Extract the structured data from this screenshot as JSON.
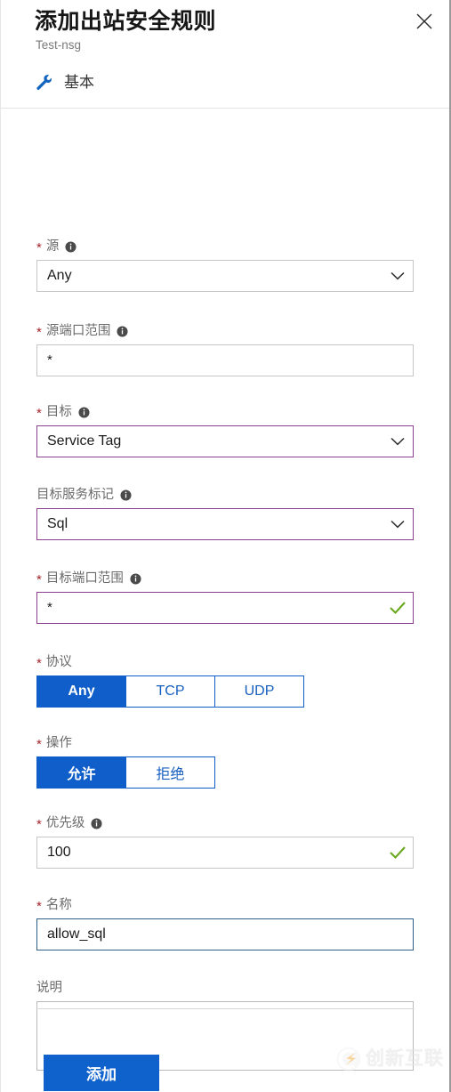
{
  "header": {
    "title": "添加出站安全规则",
    "subtitle": "Test-nsg",
    "close_icon": "close-icon",
    "tab": {
      "icon": "wrench-icon",
      "label": "基本"
    }
  },
  "colors": {
    "accent_blue": "#0f5ec9",
    "primary_button": "#0f62cc",
    "required_asterisk": "#a4262c",
    "validated_border": "#8c3f8f",
    "focus_border": "#2c5e87",
    "valid_check": "#6aa81f",
    "label_text": "#6b6b6b",
    "input_border": "#c8c6c4"
  },
  "form": {
    "source": {
      "label": "源",
      "required": true,
      "info": true,
      "value": "Any",
      "type": "dropdown"
    },
    "source_port_ranges": {
      "label": "源端口范围",
      "required": true,
      "info": true,
      "value": "*",
      "type": "text"
    },
    "destination": {
      "label": "目标",
      "required": true,
      "info": true,
      "value": "Service Tag",
      "type": "dropdown"
    },
    "destination_service_tag": {
      "label": "目标服务标记",
      "required": false,
      "info": true,
      "value": "Sql",
      "type": "dropdown"
    },
    "destination_port_ranges": {
      "label": "目标端口范围",
      "required": true,
      "info": true,
      "value": "*",
      "type": "text",
      "valid": true
    },
    "protocol": {
      "label": "协议",
      "required": true,
      "info": false,
      "options": [
        "Any",
        "TCP",
        "UDP"
      ],
      "selected": "Any"
    },
    "action": {
      "label": "操作",
      "required": true,
      "info": false,
      "options": [
        "允许",
        "拒绝"
      ],
      "selected": "允许"
    },
    "priority": {
      "label": "优先级",
      "required": true,
      "info": true,
      "value": "100",
      "type": "text",
      "valid": true
    },
    "name": {
      "label": "名称",
      "required": true,
      "info": false,
      "value": "allow_sql",
      "type": "text"
    },
    "description": {
      "label": "说明",
      "required": false,
      "info": false,
      "value": "",
      "type": "textarea"
    }
  },
  "footer": {
    "add_button": "添加"
  },
  "watermark": {
    "text": "创新互联",
    "icon": "logo-icon"
  }
}
